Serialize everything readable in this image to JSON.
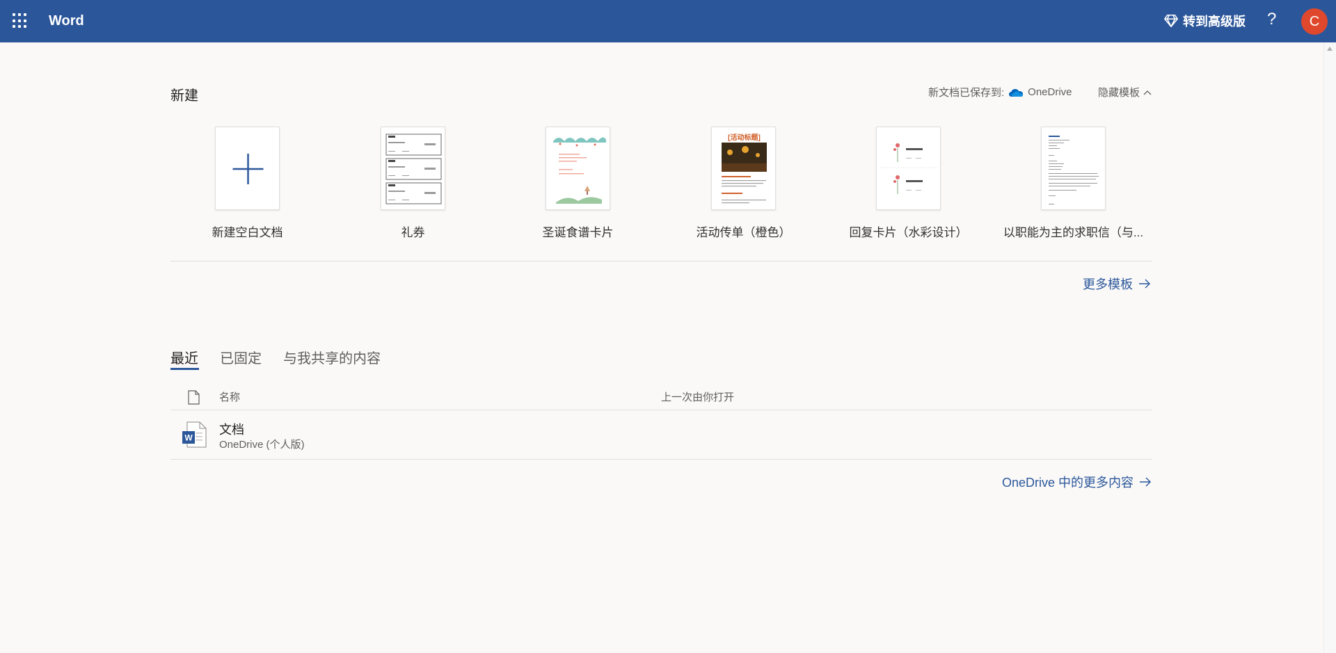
{
  "header": {
    "app_name": "Word",
    "premium_label": "转到高级版",
    "help_label": "?",
    "avatar_initial": "C",
    "avatar_color": "#e0482d",
    "brand_color": "#2b579a"
  },
  "new_section": {
    "title": "新建",
    "save_prefix": "新文档已保存到:",
    "save_target": "OneDrive",
    "hide_templates_label": "隐藏模板",
    "templates": [
      {
        "label": "新建空白文档",
        "icon": "plus-icon"
      },
      {
        "label": "礼券",
        "icon": "gift-certificate-thumbnail"
      },
      {
        "label": "圣诞食谱卡片",
        "icon": "christmas-recipe-thumbnail"
      },
      {
        "label": "活动传单（橙色）",
        "icon": "event-flyer-thumbnail",
        "thumb_heading": "[活动标题]"
      },
      {
        "label": "回复卡片（水彩设计）",
        "icon": "rsvp-card-thumbnail"
      },
      {
        "label": "以职能为主的求职信（与...",
        "icon": "cover-letter-thumbnail"
      }
    ],
    "more_templates_label": "更多模板"
  },
  "recent": {
    "tabs": [
      "最近",
      "已固定",
      "与我共享的内容"
    ],
    "active_tab": 0,
    "columns": {
      "name": "名称",
      "last_opened": "上一次由你打开"
    },
    "files": [
      {
        "name": "文档",
        "location": "OneDrive (个人版)",
        "icon": "word-file-icon"
      }
    ],
    "more_onedrive_label": "OneDrive 中的更多内容"
  }
}
